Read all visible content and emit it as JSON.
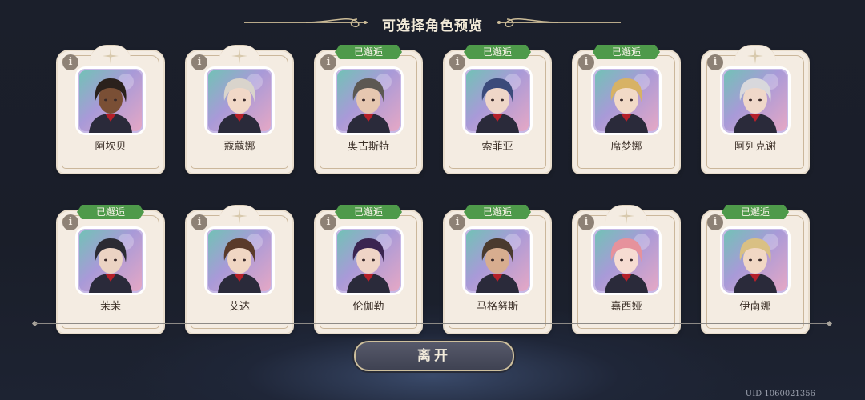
{
  "header": {
    "title": "可选择角色预览"
  },
  "info_glyph": "i",
  "met_badge": "已邂逅",
  "rows": [
    [
      {
        "name": "阿坎贝",
        "met": false,
        "hair": "#2a211c",
        "skin": "#7a4f35"
      },
      {
        "name": "蔻蔻娜",
        "met": false,
        "hair": "#d9d4cc",
        "skin": "#f1d8c7"
      },
      {
        "name": "奥古斯特",
        "met": true,
        "hair": "#5c5852",
        "skin": "#e6c7b0"
      },
      {
        "name": "索菲亚",
        "met": true,
        "hair": "#3b4a7a",
        "skin": "#efd6c8"
      },
      {
        "name": "席梦娜",
        "met": true,
        "hair": "#d7b265",
        "skin": "#f2dac7"
      },
      {
        "name": "阿列克谢",
        "met": false,
        "hair": "#d8d8dc",
        "skin": "#efd8c9"
      }
    ],
    [
      {
        "name": "茉茉",
        "met": true,
        "hair": "#2b2b33",
        "skin": "#ebd3c3"
      },
      {
        "name": "艾达",
        "met": false,
        "hair": "#5a3a2a",
        "skin": "#f0d6c3"
      },
      {
        "name": "伦伽勒",
        "met": true,
        "hair": "#3a2450",
        "skin": "#efd4c6"
      },
      {
        "name": "马格努斯",
        "met": true,
        "hair": "#4a3a2e",
        "skin": "#d7ad8f"
      },
      {
        "name": "嘉西娅",
        "met": false,
        "hair": "#e6929c",
        "skin": "#f6dcd2"
      },
      {
        "name": "伊南娜",
        "met": true,
        "hair": "#d9c084",
        "skin": "#f1d7c4"
      }
    ]
  ],
  "footer": {
    "leave_label": "离开",
    "uid": "UID 1060021356"
  }
}
